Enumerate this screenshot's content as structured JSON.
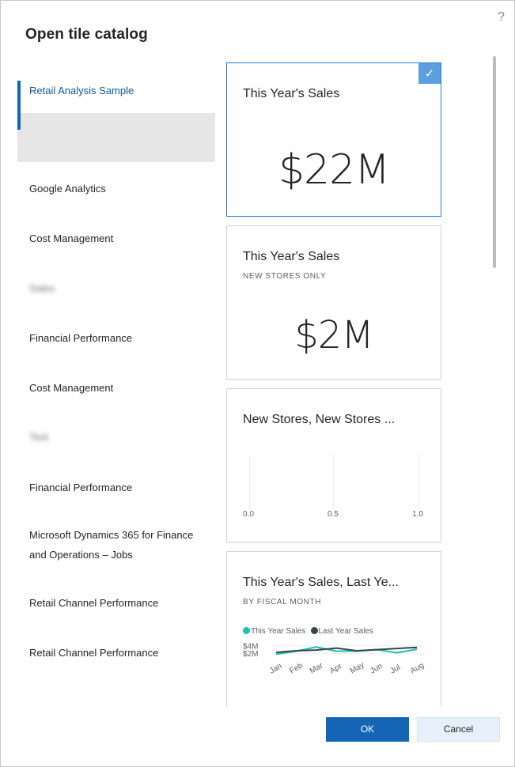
{
  "dialog": {
    "title": "Open tile catalog",
    "help_label": "?"
  },
  "sidebar": {
    "items": [
      {
        "label": "Retail Analysis Sample",
        "active": true
      },
      {
        "label": "Google Analytics"
      },
      {
        "label": "Cost Management"
      },
      {
        "label": "Sales",
        "blurred": true
      },
      {
        "label": "Financial Performance"
      },
      {
        "label": "Cost Management"
      },
      {
        "label": "Test",
        "blurred": true
      },
      {
        "label": "Financial Performance"
      },
      {
        "label": "Microsoft Dynamics 365 for Finance and Operations – Jobs"
      },
      {
        "label": "Retail Channel Performance"
      },
      {
        "label": "Retail Channel Performance"
      }
    ]
  },
  "tiles": [
    {
      "title": "This Year's Sales",
      "value": "$22M",
      "selected": true
    },
    {
      "title": "This Year's Sales",
      "subtitle": "NEW STORES ONLY",
      "value": "$2M"
    },
    {
      "title": "New Stores, New Stores ...",
      "axis_ticks": [
        "0.0",
        "0.5",
        "1.0"
      ]
    },
    {
      "title": "This Year's Sales, Last Ye...",
      "subtitle": "BY FISCAL MONTH",
      "chart_data": {
        "type": "line",
        "categories": [
          "Jan",
          "Feb",
          "Mar",
          "Apr",
          "May",
          "Jun",
          "Jul",
          "Aug"
        ],
        "series": [
          {
            "name": "This Year Sales",
            "color": "#1dbfb0",
            "values": [
              1.8,
              2.6,
              3.7,
              2.6,
              2.6,
              3.0,
              2.2,
              3.1
            ]
          },
          {
            "name": "Last Year Sales",
            "color": "#374649",
            "values": [
              2.3,
              2.7,
              2.9,
              3.4,
              2.7,
              3.0,
              3.3,
              3.6
            ]
          }
        ],
        "y_ticks": [
          "$4M",
          "$2M"
        ],
        "ylim": [
          0,
          5
        ]
      }
    }
  ],
  "buttons": {
    "ok": "OK",
    "cancel": "Cancel"
  },
  "colors": {
    "accent": "#1565b7",
    "selected_border": "#1f7ed6",
    "this_year": "#1dbfb0",
    "last_year": "#374649"
  }
}
